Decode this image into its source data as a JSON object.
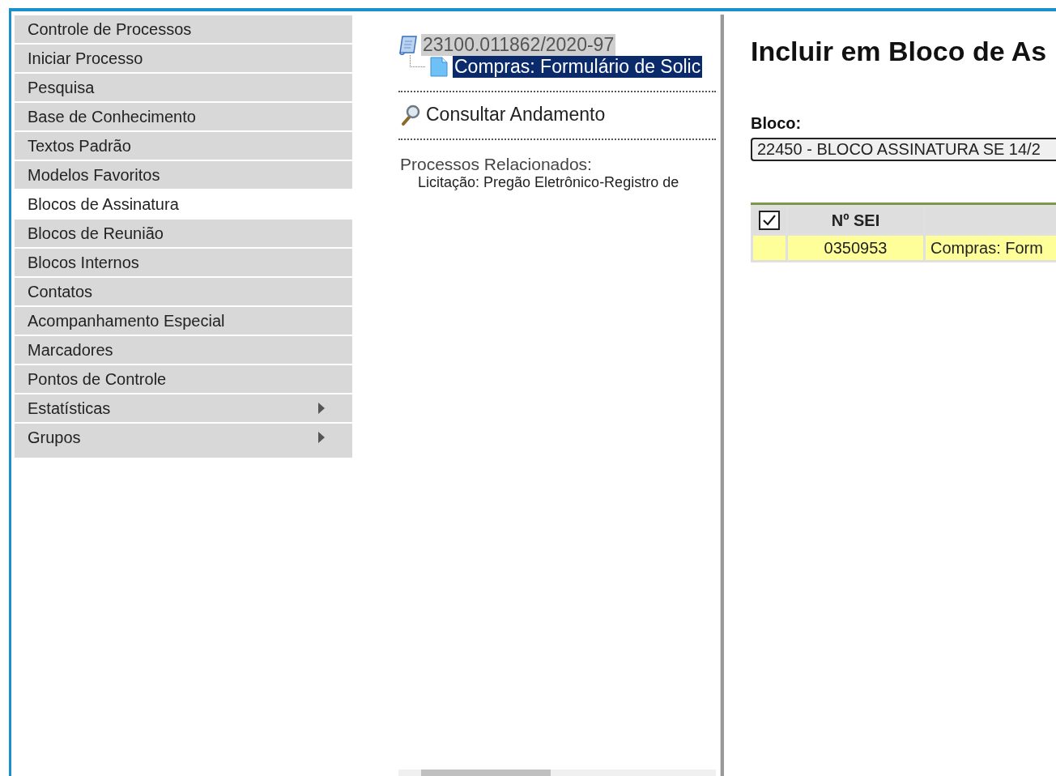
{
  "menu": [
    {
      "label": "Controle de Processos",
      "selected": false,
      "kind": "link"
    },
    {
      "label": "Iniciar Processo",
      "selected": false,
      "kind": "link"
    },
    {
      "label": "Pesquisa",
      "selected": false,
      "kind": "link"
    },
    {
      "label": "Base de Conhecimento",
      "selected": false,
      "kind": "link"
    },
    {
      "label": "Textos Padrão",
      "selected": false,
      "kind": "link"
    },
    {
      "label": "Modelos Favoritos",
      "selected": false,
      "kind": "link"
    },
    {
      "label": "Blocos de Assinatura",
      "selected": true,
      "kind": "link"
    },
    {
      "label": "Blocos de Reunião",
      "selected": false,
      "kind": "link"
    },
    {
      "label": "Blocos Internos",
      "selected": false,
      "kind": "link"
    },
    {
      "label": "Contatos",
      "selected": false,
      "kind": "link"
    },
    {
      "label": "Acompanhamento Especial",
      "selected": false,
      "kind": "link"
    },
    {
      "label": "Marcadores",
      "selected": false,
      "kind": "link"
    },
    {
      "label": "Pontos de Controle",
      "selected": false,
      "kind": "link"
    },
    {
      "label": "Estatísticas",
      "selected": false,
      "kind": "submenu"
    },
    {
      "label": "Grupos",
      "selected": false,
      "kind": "submenu"
    }
  ],
  "tree": {
    "process": {
      "label": "23100.011862/2020-97",
      "selected": false
    },
    "documents": [
      {
        "label": "Compras: Formulário de Solic",
        "selected": true
      }
    ]
  },
  "consult_link": "Consultar Andamento",
  "related": {
    "title": "Processos Relacionados:",
    "items": [
      "Licitação: Pregão Eletrônico-Registro de"
    ]
  },
  "form": {
    "title": "Incluir em Bloco de As",
    "bloco_label": "Bloco:",
    "bloco_value": "22450 - BLOCO ASSINATURA SE 14/2"
  },
  "table": {
    "select_all_checked": true,
    "columns": [
      "Nº SEI"
    ],
    "rows": [
      {
        "selected": true,
        "number": "0350953",
        "document": "Compras: Form"
      }
    ]
  }
}
